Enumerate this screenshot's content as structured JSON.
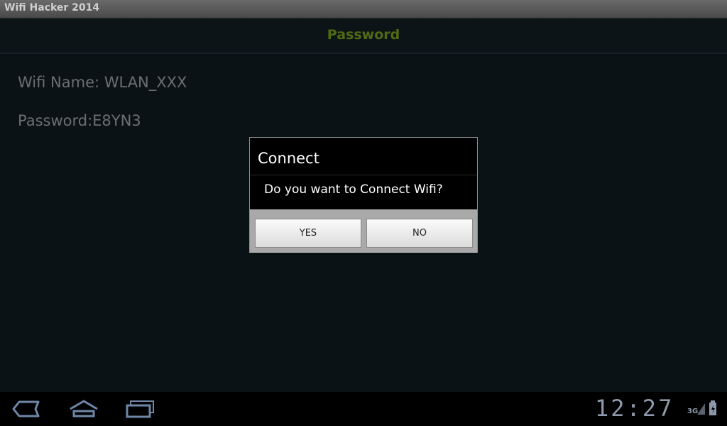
{
  "window": {
    "title": "Wifi Hacker 2014"
  },
  "action_bar": {
    "title": "Password"
  },
  "info": {
    "wifi_name": "Wifi Name: WLAN_XXX",
    "password": "Password:E8YN3"
  },
  "dialog": {
    "title": "Connect",
    "message": "Do you want to Connect Wifi?",
    "yes_label": "YES",
    "no_label": "NO"
  },
  "status": {
    "time": "12:27",
    "network": "3G"
  },
  "nav": {
    "icons": [
      "back-icon",
      "home-icon",
      "recent-apps-icon"
    ]
  },
  "colors": {
    "accent": "#4f6b12",
    "background": "#0c1316",
    "clock": "#8e9aab"
  }
}
